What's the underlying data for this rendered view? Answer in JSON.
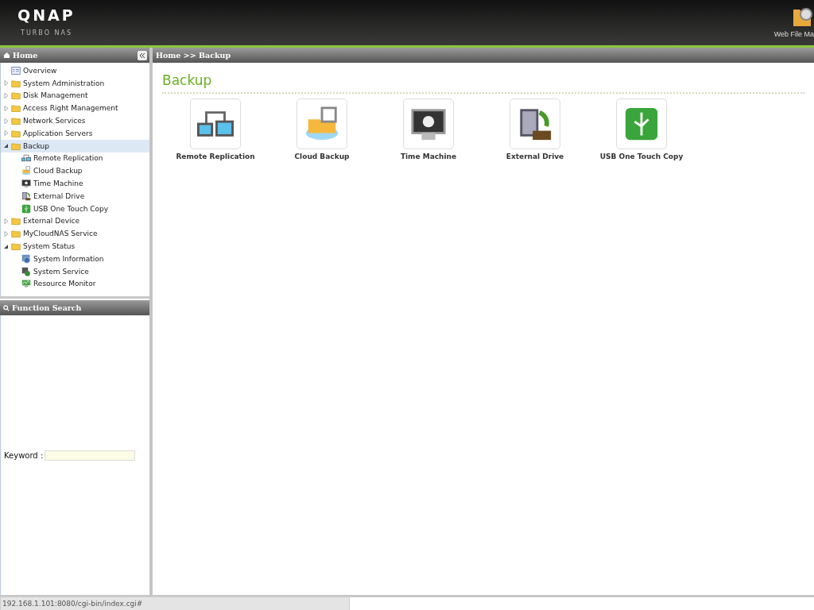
{
  "header": {
    "logo": "QNAP",
    "subtitle": "TURBO NAS",
    "shortcut": "Web File Ma"
  },
  "sidebar": {
    "title": "Home",
    "tree": [
      {
        "label": "Overview",
        "kind": "overview",
        "selected": false
      },
      {
        "label": "System Administration",
        "kind": "folder",
        "expanded": false,
        "selected": false
      },
      {
        "label": "Disk Management",
        "kind": "folder",
        "expanded": false,
        "selected": false
      },
      {
        "label": "Access Right Management",
        "kind": "folder",
        "expanded": false,
        "selected": false
      },
      {
        "label": "Network Services",
        "kind": "folder",
        "expanded": false,
        "selected": false
      },
      {
        "label": "Application Servers",
        "kind": "folder",
        "expanded": false,
        "selected": false
      },
      {
        "label": "Backup",
        "kind": "folder",
        "expanded": true,
        "selected": true,
        "children": [
          {
            "label": "Remote Replication",
            "kind": "replication",
            "selected": false
          },
          {
            "label": "Cloud Backup",
            "kind": "cloud",
            "selected": false
          },
          {
            "label": "Time Machine",
            "kind": "apple",
            "selected": false
          },
          {
            "label": "External Drive",
            "kind": "drive",
            "selected": false
          },
          {
            "label": "USB One Touch Copy",
            "kind": "usb",
            "selected": false
          }
        ]
      },
      {
        "label": "External Device",
        "kind": "folder",
        "expanded": false,
        "selected": false
      },
      {
        "label": "MyCloudNAS Service",
        "kind": "folder",
        "expanded": false,
        "selected": false
      },
      {
        "label": "System Status",
        "kind": "folder",
        "expanded": true,
        "selected": false,
        "children": [
          {
            "label": "System Information",
            "kind": "info",
            "selected": false
          },
          {
            "label": "System Service",
            "kind": "service",
            "selected": false
          },
          {
            "label": "Resource Monitor",
            "kind": "monitor",
            "selected": false
          }
        ]
      }
    ]
  },
  "function_search": {
    "title": "Function Search",
    "keyword_label": "Keyword :"
  },
  "breadcrumb": "Home >> Backup",
  "page_title": "Backup",
  "tiles": [
    {
      "label": "Remote Replication",
      "kind": "replication"
    },
    {
      "label": "Cloud Backup",
      "kind": "cloud"
    },
    {
      "label": "Time Machine",
      "kind": "apple"
    },
    {
      "label": "External Drive",
      "kind": "drive"
    },
    {
      "label": "USB One Touch Copy",
      "kind": "usb"
    }
  ],
  "status_bar": "192.168.1.101:8080/cgi-bin/index.cgi#"
}
